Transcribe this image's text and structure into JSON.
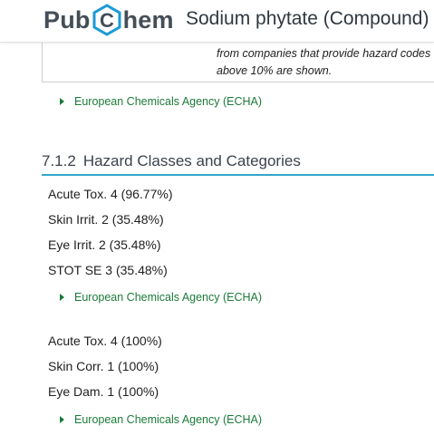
{
  "header": {
    "logo_left": "Pub",
    "logo_hex_letter": "C",
    "logo_right": "hem",
    "compound_title": "Sodium phytate (Compound)"
  },
  "note": {
    "line1": "from companies that provide hazard codes",
    "line2": "above 10% are shown."
  },
  "section": {
    "number": "7.1.2",
    "title": "Hazard Classes and Categories"
  },
  "reference_label": "European Chemicals Agency (ECHA)",
  "groups": [
    {
      "items": [
        "Acute Tox. 4 (96.77%)",
        "Skin Irrit. 2 (35.48%)",
        "Eye Irrit. 2 (35.48%)",
        "STOT SE 3 (35.48%)"
      ],
      "reference": "European Chemicals Agency (ECHA)"
    },
    {
      "items": [
        "Acute Tox. 4 (100%)",
        "Skin Corr. 1 (100%)",
        "Eye Dam. 1 (100%)"
      ],
      "reference": "European Chemicals Agency (ECHA)"
    }
  ],
  "colors": {
    "logo_text": "#444e57",
    "logo_hex": "#1a9bd7",
    "link_green": "#1c7a3a",
    "heading_rule": "#32a6c9"
  },
  "icons": {
    "logo_hexagon": "hexagon-icon",
    "reference_expander": "triangle-right-icon"
  }
}
